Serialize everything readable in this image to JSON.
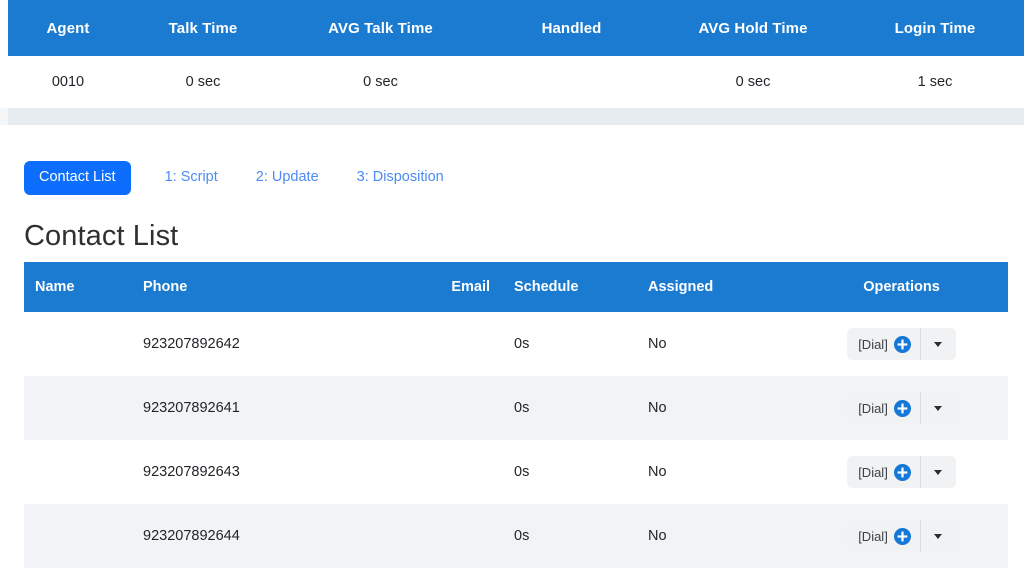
{
  "colors": {
    "table_header_blue": "#1b7bd0",
    "active_tab_blue": "#0d6efd",
    "link_blue": "#4c8bf5",
    "plus_icon_blue": "#1577d6",
    "row_stripe_gray": "#f2f3f6",
    "separator_band": "#e7ecf0",
    "button_group_bg": "#f1f2f4"
  },
  "agent_stats": {
    "columns": [
      "Agent",
      "Talk Time",
      "AVG Talk Time",
      "Handled",
      "AVG Hold Time",
      "Login Time"
    ],
    "rows": [
      {
        "agent": "0010",
        "talk_time": "0 sec",
        "avg_talk_time": "0 sec",
        "handled": "",
        "avg_hold_time": "0 sec",
        "login_time": "1 sec"
      }
    ]
  },
  "tabs": {
    "active": "Contact List",
    "items": [
      {
        "label": "Contact List",
        "active": true
      },
      {
        "label": "1: Script",
        "active": false
      },
      {
        "label": "2: Update",
        "active": false
      },
      {
        "label": "3: Disposition",
        "active": false
      }
    ]
  },
  "page": {
    "heading": "Contact List"
  },
  "contact_list": {
    "columns": [
      "Name",
      "Phone",
      "Email",
      "Schedule",
      "Assigned",
      "Operations"
    ],
    "operations": {
      "dial_label": "[Dial]",
      "plus_icon": "circle-plus-icon",
      "caret_icon": "chevron-down-icon"
    },
    "rows": [
      {
        "name": "",
        "phone": "923207892642",
        "email": "",
        "schedule": "0s",
        "assigned": "No"
      },
      {
        "name": "",
        "phone": "923207892641",
        "email": "",
        "schedule": "0s",
        "assigned": "No"
      },
      {
        "name": "",
        "phone": "923207892643",
        "email": "",
        "schedule": "0s",
        "assigned": "No"
      },
      {
        "name": "",
        "phone": "923207892644",
        "email": "",
        "schedule": "0s",
        "assigned": "No"
      }
    ]
  }
}
